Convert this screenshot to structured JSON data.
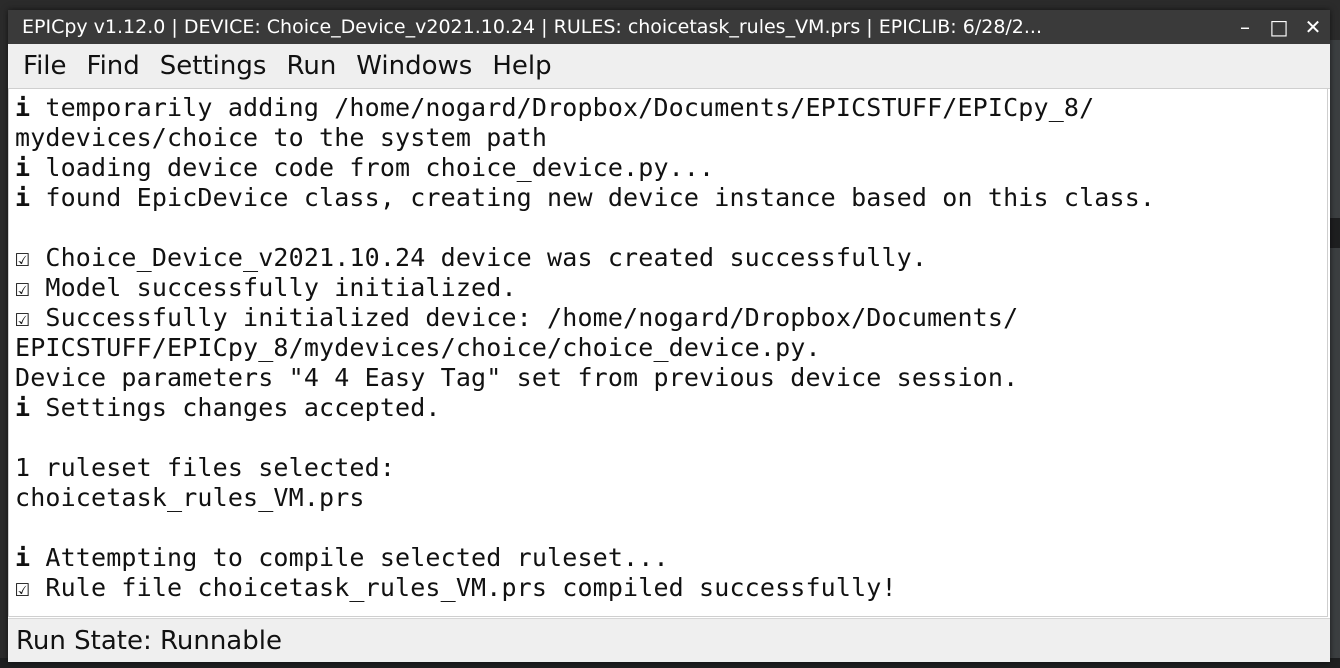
{
  "window": {
    "title": "EPICpy v1.12.0 | DEVICE: Choice_Device_v2021.10.24 | RULES: choicetask_rules_VM.prs | EPICLIB: 6/28/2..."
  },
  "window_controls": {
    "minimize": "–",
    "maximize": "□",
    "close": "✕"
  },
  "menubar": {
    "items": [
      "File",
      "Find",
      "Settings",
      "Run",
      "Windows",
      "Help"
    ]
  },
  "log": {
    "lines": [
      {
        "marker": "i",
        "text": " temporarily adding /home/nogard/Dropbox/Documents/EPICSTUFF/EPICpy_8/"
      },
      {
        "marker": "",
        "text": "mydevices/choice to the system path"
      },
      {
        "marker": "i",
        "text": " loading device code from choice_device.py..."
      },
      {
        "marker": "i",
        "text": " found EpicDevice class, creating new device instance based on this class."
      },
      {
        "marker": "",
        "text": ""
      },
      {
        "marker": "☑",
        "text": " Choice_Device_v2021.10.24 device was created successfully."
      },
      {
        "marker": "☑",
        "text": " Model successfully initialized."
      },
      {
        "marker": "☑",
        "text": " Successfully initialized device: /home/nogard/Dropbox/Documents/"
      },
      {
        "marker": "",
        "text": "EPICSTUFF/EPICpy_8/mydevices/choice/choice_device.py."
      },
      {
        "marker": "",
        "text": "Device parameters \"4 4 Easy Tag\" set from previous device session."
      },
      {
        "marker": "i",
        "text": " Settings changes accepted."
      },
      {
        "marker": "",
        "text": ""
      },
      {
        "marker": "",
        "text": "1 ruleset files selected:"
      },
      {
        "marker": "",
        "text": "choicetask_rules_VM.prs"
      },
      {
        "marker": "",
        "text": ""
      },
      {
        "marker": "i",
        "text": " Attempting to compile selected ruleset..."
      },
      {
        "marker": "☑",
        "text": " Rule file choicetask_rules_VM.prs compiled successfully!"
      }
    ]
  },
  "statusbar": {
    "text": "Run State: Runnable"
  }
}
